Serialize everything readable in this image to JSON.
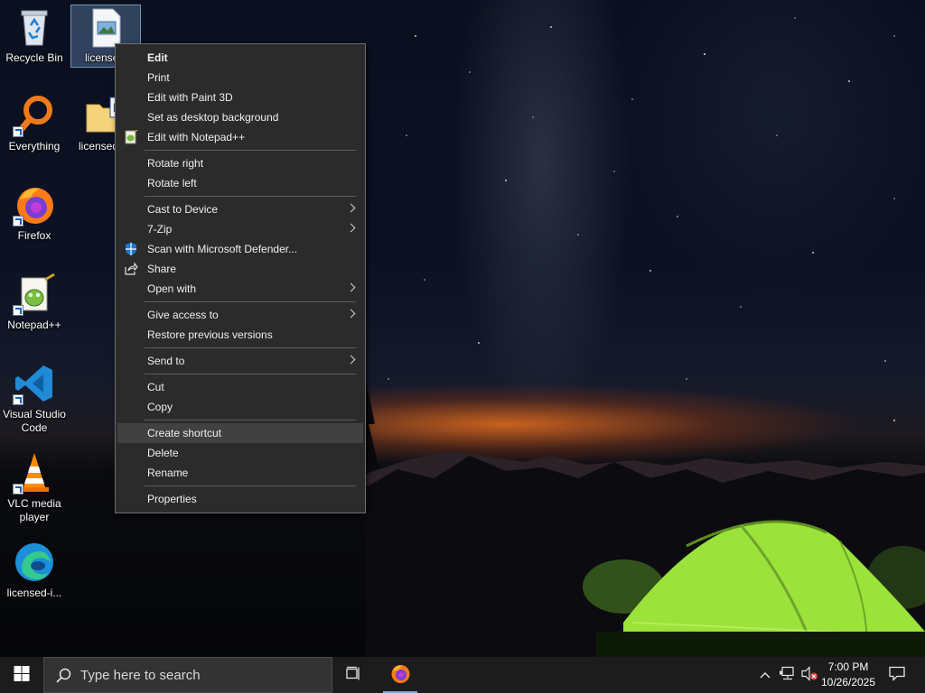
{
  "desktop": {
    "icons": [
      {
        "label": "Recycle Bin",
        "icon": "recycle-bin-icon"
      },
      {
        "label": "license",
        "icon": "image-file-icon",
        "selected": true
      },
      {
        "label": "Everything",
        "icon": "everything-search-icon"
      },
      {
        "label": "licensed",
        "icon": "folder-icon"
      },
      {
        "label": "Firefox",
        "icon": "firefox-icon"
      },
      {
        "label": "Notepad++",
        "icon": "notepad-plus-plus-icon"
      },
      {
        "label": "Visual Studio Code",
        "icon": "vscode-icon"
      },
      {
        "label": "VLC media player",
        "icon": "vlc-icon"
      },
      {
        "label": "licensed-i...",
        "icon": "edge-icon"
      }
    ]
  },
  "context_menu": {
    "items": [
      {
        "label": "Edit",
        "bold": true
      },
      {
        "label": "Print"
      },
      {
        "label": "Edit with Paint 3D"
      },
      {
        "label": "Set as desktop background"
      },
      {
        "label": "Edit with Notepad++",
        "icon": "notepad-plus-plus-icon"
      },
      {
        "label": "Rotate right"
      },
      {
        "label": "Rotate left"
      },
      {
        "label": "Cast to Device",
        "submenu": true
      },
      {
        "label": "7-Zip",
        "submenu": true
      },
      {
        "label": "Scan with Microsoft Defender...",
        "icon": "defender-shield-icon"
      },
      {
        "label": "Share",
        "icon": "share-icon"
      },
      {
        "label": "Open with",
        "submenu": true
      },
      {
        "label": "Give access to",
        "submenu": true
      },
      {
        "label": "Restore previous versions"
      },
      {
        "label": "Send to",
        "submenu": true
      },
      {
        "label": "Cut"
      },
      {
        "label": "Copy"
      },
      {
        "label": "Create shortcut",
        "highlighted": true
      },
      {
        "label": "Delete"
      },
      {
        "label": "Rename"
      },
      {
        "label": "Properties"
      }
    ]
  },
  "taskbar": {
    "search_placeholder": "Type here to search",
    "pinned": [
      "task-view-icon",
      "firefox-icon"
    ],
    "clock_time": "7:00 PM",
    "clock_date": "10/26/2025"
  },
  "colors": {
    "menu_bg": "#2b2b2b",
    "menu_highlight": "#414141",
    "taskbar_bg": "#1c1c1c",
    "tent_green": "#9be23a"
  }
}
